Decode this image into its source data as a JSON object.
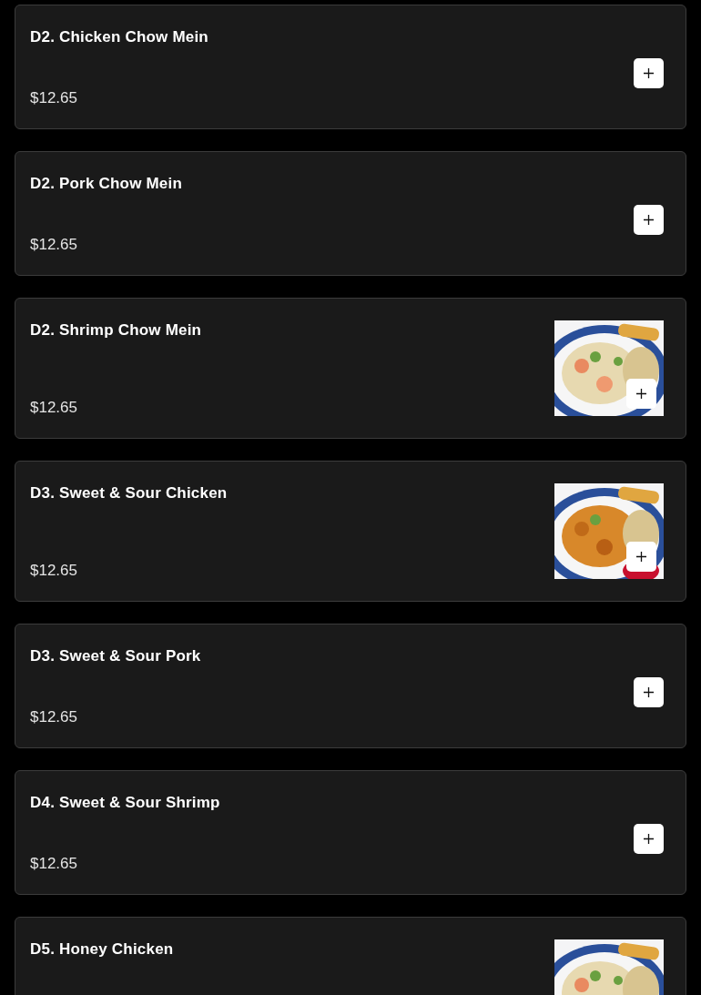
{
  "menu_items": [
    {
      "name": "D2. Chicken Chow Mein",
      "price": "$12.65",
      "kind": "plain"
    },
    {
      "name": "D2. Pork Chow Mein",
      "price": "$12.65",
      "kind": "plain"
    },
    {
      "name": "D2. Shrimp Chow Mein",
      "price": "$12.65",
      "kind": "picture"
    },
    {
      "name": "D3. Sweet & Sour Chicken",
      "price": "$12.65",
      "kind": "picture"
    },
    {
      "name": "D3. Sweet & Sour Pork",
      "price": "$12.65",
      "kind": "plain"
    },
    {
      "name": "D4. Sweet & Sour Shrimp",
      "price": "$12.65",
      "kind": "plain"
    },
    {
      "name": "D5. Honey Chicken",
      "kind": "picture"
    }
  ]
}
